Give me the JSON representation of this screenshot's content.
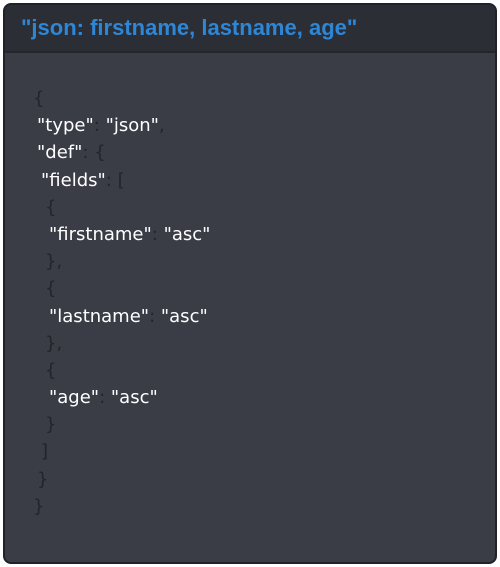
{
  "header": {
    "title": "\"json: firstname, lastname, age\""
  },
  "code": {
    "lines": [
      {
        "indent": 0,
        "tokens": [
          {
            "t": "{",
            "k": "punc"
          }
        ]
      },
      {
        "indent": 1,
        "tokens": [
          {
            "t": "\"type\"",
            "k": "txt"
          },
          {
            "t": ": ",
            "k": "punc"
          },
          {
            "t": "\"json\"",
            "k": "txt"
          },
          {
            "t": ",",
            "k": "punc"
          }
        ]
      },
      {
        "indent": 1,
        "tokens": [
          {
            "t": "\"def\"",
            "k": "txt"
          },
          {
            "t": ": {",
            "k": "punc"
          }
        ]
      },
      {
        "indent": 2,
        "tokens": [
          {
            "t": "\"fields\"",
            "k": "txt"
          },
          {
            "t": ": [",
            "k": "punc"
          }
        ]
      },
      {
        "indent": 3,
        "tokens": [
          {
            "t": "{",
            "k": "punc"
          }
        ]
      },
      {
        "indent": 4,
        "tokens": [
          {
            "t": "\"firstname\"",
            "k": "txt"
          },
          {
            "t": ": ",
            "k": "punc"
          },
          {
            "t": "\"asc\"",
            "k": "txt"
          }
        ]
      },
      {
        "indent": 3,
        "tokens": [
          {
            "t": "},",
            "k": "punc"
          }
        ]
      },
      {
        "indent": 3,
        "tokens": [
          {
            "t": "{",
            "k": "punc"
          }
        ]
      },
      {
        "indent": 4,
        "tokens": [
          {
            "t": "\"lastname\"",
            "k": "txt"
          },
          {
            "t": ": ",
            "k": "punc"
          },
          {
            "t": "\"asc\"",
            "k": "txt"
          }
        ]
      },
      {
        "indent": 3,
        "tokens": [
          {
            "t": "},",
            "k": "punc"
          }
        ]
      },
      {
        "indent": 3,
        "tokens": [
          {
            "t": "{",
            "k": "punc"
          }
        ]
      },
      {
        "indent": 4,
        "tokens": [
          {
            "t": "\"age\"",
            "k": "txt"
          },
          {
            "t": ": ",
            "k": "punc"
          },
          {
            "t": "\"asc\"",
            "k": "txt"
          }
        ]
      },
      {
        "indent": 3,
        "tokens": [
          {
            "t": "}",
            "k": "punc"
          }
        ]
      },
      {
        "indent": 2,
        "tokens": [
          {
            "t": "]",
            "k": "punc"
          }
        ]
      },
      {
        "indent": 1,
        "tokens": [
          {
            "t": "}",
            "k": "punc"
          }
        ]
      },
      {
        "indent": 0,
        "tokens": [
          {
            "t": "}",
            "k": "punc"
          }
        ]
      }
    ]
  },
  "colors": {
    "title": "#2e86d6",
    "card_background": "#3a3d46",
    "header_background": "#2b2e35",
    "text": "#ffffff",
    "punctuation": "#232429"
  }
}
